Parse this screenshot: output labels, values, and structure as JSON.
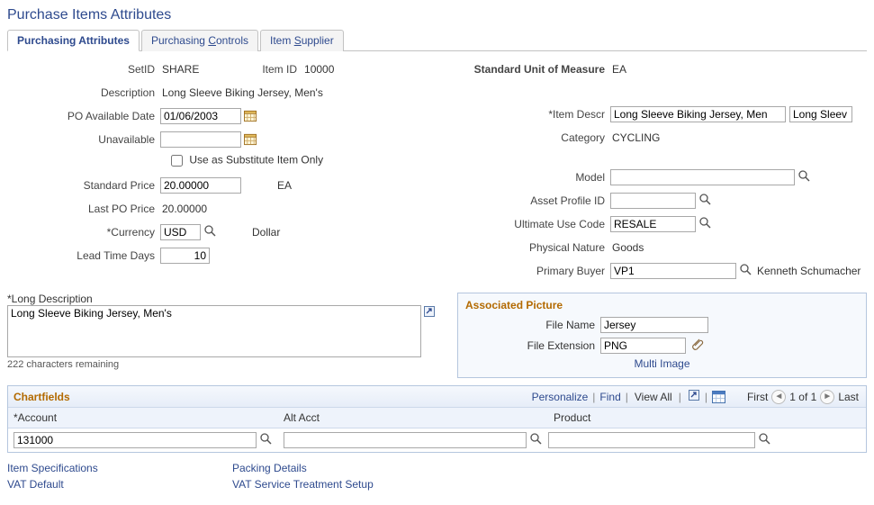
{
  "page_title": "Purchase Items Attributes",
  "tabs": {
    "t1_pre": "Purchasin",
    "t1_ul": "g",
    "t1_post": " Attributes",
    "t2_pre": "Purchasing ",
    "t2_ul": "C",
    "t2_post": "ontrols",
    "t3_pre": "Item ",
    "t3_ul": "S",
    "t3_post": "upplier"
  },
  "left": {
    "setid_lbl": "SetID",
    "setid_val": "SHARE",
    "itemid_lbl": "Item ID",
    "itemid_val": "10000",
    "desc_lbl": "Description",
    "desc_val": "Long Sleeve Biking Jersey, Men's",
    "poavail_lbl": "PO Available Date",
    "poavail_val": "01/06/2003",
    "unavail_lbl": "Unavailable",
    "unavail_val": "",
    "subst_lbl": "Use as Substitute Item Only",
    "stdprice_lbl": "Standard Price",
    "stdprice_val": "20.00000",
    "stdprice_unit": "EA",
    "lastpo_lbl": "Last PO Price",
    "lastpo_val": "20.00000",
    "curr_lbl": "*Currency",
    "curr_val": "USD",
    "curr_name": "Dollar",
    "lead_lbl": "Lead Time Days",
    "lead_val": "10"
  },
  "right": {
    "stduom_lbl": "Standard Unit of Measure",
    "stduom_val": "EA",
    "itemdescr_lbl": "*Item Descr",
    "itemdescr_val": "Long Sleeve Biking Jersey, Men",
    "itemdescr_val2": "Long Sleev",
    "cat_lbl": "Category",
    "cat_val": "CYCLING",
    "model_lbl": "Model",
    "model_val": "",
    "assetprof_lbl": "Asset Profile ID",
    "assetprof_val": "",
    "ultuse_lbl": "Ultimate Use Code",
    "ultuse_val": "RESALE",
    "physnat_lbl": "Physical Nature",
    "physnat_val": "Goods",
    "primbuyer_lbl": "Primary Buyer",
    "primbuyer_val": "VP1",
    "primbuyer_name": "Kenneth Schumacher"
  },
  "longdesc": {
    "lbl": "*Long Description",
    "val": "Long Sleeve Biking Jersey, Men's",
    "remaining": "222 characters remaining"
  },
  "assoc": {
    "title": "Associated Picture",
    "filename_lbl": "File Name",
    "filename_val": "Jersey",
    "fileext_lbl": "File Extension",
    "fileext_val": "PNG",
    "multi_link": "Multi Image"
  },
  "grid": {
    "title": "Chartfields",
    "personalize": "Personalize",
    "find": "Find",
    "viewall": "View All",
    "first": "First",
    "last": "Last",
    "count": "1 of 1",
    "col1": "*Account",
    "col2": "Alt Acct",
    "col3": "Product",
    "account_val": "131000",
    "altacct_val": "",
    "product_val": ""
  },
  "links": {
    "l1": "Item Specifications",
    "l2": "VAT Default",
    "l3": "Packing Details",
    "l4": "VAT Service Treatment Setup"
  }
}
